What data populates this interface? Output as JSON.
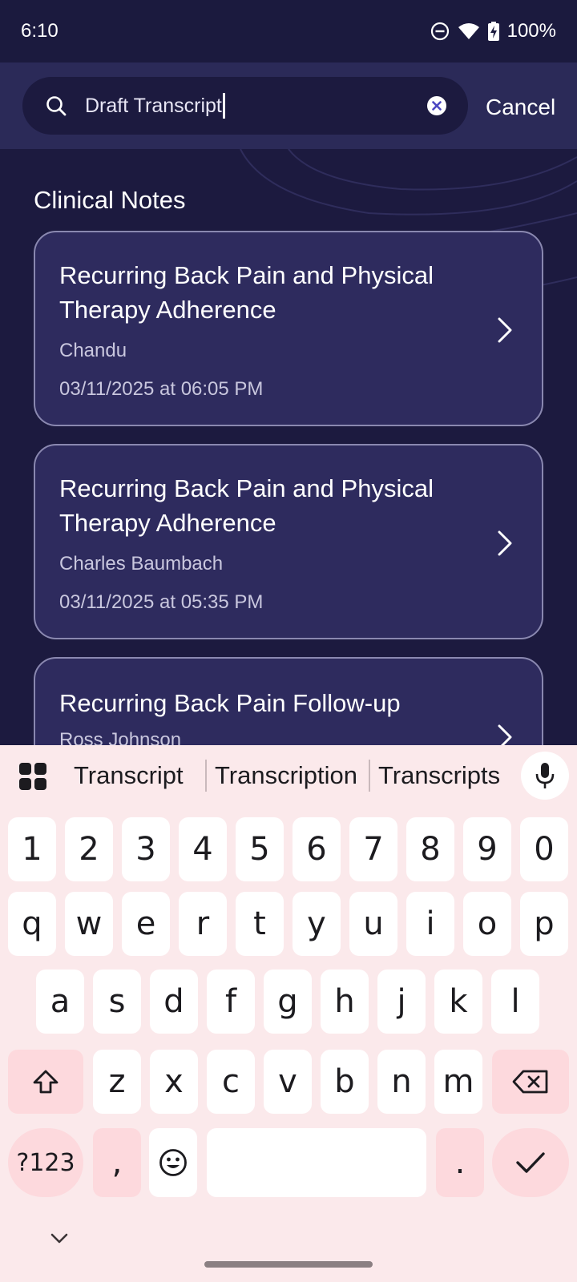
{
  "status_bar": {
    "time": "6:10",
    "battery": "100%",
    "icons": [
      "do-not-disturb-icon",
      "wifi-icon",
      "battery-charging-icon"
    ]
  },
  "search": {
    "value": "Draft Transcript",
    "cancel_label": "Cancel"
  },
  "section": {
    "title": "Clinical Notes"
  },
  "notes": [
    {
      "title": "Recurring Back Pain and Physical Therapy Adherence",
      "author": "Chandu",
      "date": "03/11/2025 at 06:05 PM"
    },
    {
      "title": "Recurring Back Pain and Physical Therapy Adherence",
      "author": "Charles Baumbach",
      "date": "03/11/2025 at 05:35 PM"
    },
    {
      "title": "Recurring Back Pain Follow-up",
      "author": "Ross Johnson",
      "date": ""
    }
  ],
  "keyboard": {
    "suggestions": [
      "Transcript",
      "Transcription",
      "Transcripts"
    ],
    "row_numbers": [
      "1",
      "2",
      "3",
      "4",
      "5",
      "6",
      "7",
      "8",
      "9",
      "0"
    ],
    "row_top": [
      "q",
      "w",
      "e",
      "r",
      "t",
      "y",
      "u",
      "i",
      "o",
      "p"
    ],
    "row_middle": [
      "a",
      "s",
      "d",
      "f",
      "g",
      "h",
      "j",
      "k",
      "l"
    ],
    "row_bottom": [
      "z",
      "x",
      "c",
      "v",
      "b",
      "n",
      "m"
    ],
    "symbols_label": "?123",
    "comma": ",",
    "period": "."
  },
  "colors": {
    "background": "#1c1a3f",
    "card": "#2e2b5e",
    "search_bar": "#2b2a58",
    "keyboard": "#fbe9eb",
    "function_key": "#fdd9dd"
  }
}
